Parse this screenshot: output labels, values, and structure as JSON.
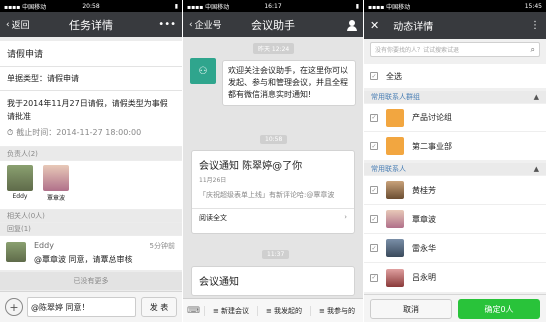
{
  "panel1": {
    "status": {
      "carrier": "▪▪▪▪ 中国移动",
      "time": "20:58",
      "battery": "▮"
    },
    "nav": {
      "back": "返回",
      "title": "任务详情",
      "more": "•••"
    },
    "task": {
      "title": "请假申请",
      "type": "单据类型：请假申请",
      "desc": "我于2014年11月27日请假，请假类型为事假 请批准",
      "deadline": "截止时间：2014-11-27 18:00:00"
    },
    "assignee_header": "负责人(2)",
    "assignees": [
      {
        "name": "Eddy"
      },
      {
        "name": "覃章波"
      }
    ],
    "related_header": "相关人(0人)",
    "reply_header": "回复(1)",
    "reply": {
      "name": "Eddy",
      "time": "5分钟前",
      "text": "@覃章波 同意，请覃总审核"
    },
    "no_more": "已没有更多",
    "input": {
      "value": "@陈翠婷 同意！",
      "send": "发 表"
    }
  },
  "panel2": {
    "status": {
      "carrier": "▪▪▪▪ 中国移动",
      "time": "16:17",
      "battery": "▮"
    },
    "nav": {
      "back": "企业号",
      "title": "会议助手"
    },
    "time1": "昨天 12:24",
    "welcome": "欢迎关注会议助手，在这里你可以发起、参与和管理会议，并且全程都有微信消息实时通知!",
    "time2": "10:58",
    "notice": {
      "title": "会议通知 陈翠婷@了你",
      "date": "11月26日",
      "body": "「庆祝超级表单上线」有新评论哈:@覃章波",
      "read": "阅读全文"
    },
    "time3": "11:37",
    "notice2": {
      "title": "会议通知"
    },
    "menu": [
      "新建会议",
      "我发起的",
      "我参与的"
    ]
  },
  "panel3": {
    "status": {
      "carrier": "▪▪▪▪ 中国移动",
      "time": "15:45"
    },
    "nav": {
      "title": "动态详情",
      "more": "⋮"
    },
    "search_placeholder": "没有你要找的人？试试搜索试退",
    "select_all": "全选",
    "groups_header": "常用联系人群组",
    "groups": [
      {
        "name": "产品讨论组"
      },
      {
        "name": "第二事业部"
      }
    ],
    "contacts_header": "常用联系人",
    "contacts": [
      {
        "name": "黄桂芳"
      },
      {
        "name": "覃章波"
      },
      {
        "name": "雷永华"
      },
      {
        "name": "吕永明"
      }
    ],
    "cancel": "取消",
    "confirm": "确定0人"
  },
  "colors": {
    "nav": "#383a3e",
    "green": "#29c33a",
    "orange": "#f2a640",
    "teal": "#2fa58d"
  }
}
